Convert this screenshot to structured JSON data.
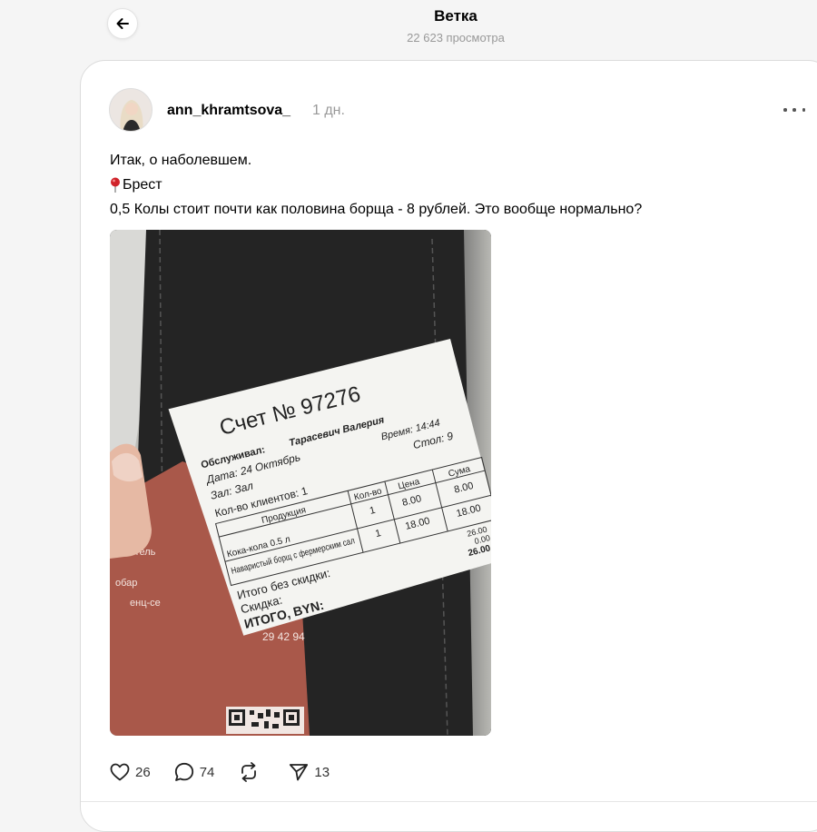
{
  "header": {
    "title": "Ветка",
    "views": "22 623 просмотра"
  },
  "post": {
    "username": "ann_khramtsova_",
    "time": "1 дн.",
    "lines": [
      "Итак, о наболевшем.",
      "Брест",
      "0,5 Колы стоит почти как половина борща - 8 рублей. Это вообще нормально?"
    ],
    "receipt": {
      "title": "Счет № 97276",
      "served_label": "Обслуживал:",
      "waiter": "Тарасевич Валерия",
      "date": "Дата: 24 Октябрь",
      "time": "Время: 14:44",
      "hall": "Зал: Зал",
      "table": "Стол: 9",
      "clients": "Кол-во клиентов: 1",
      "col_product": "Продукция",
      "col_qty": "Кол-во",
      "col_price": "Цена",
      "col_sum": "Сума",
      "items": [
        {
          "name": "Кока-кола 0.5 л",
          "qty": "1",
          "price": "8.00",
          "sum": "8.00"
        },
        {
          "name": "Наваристый борщ с фермерским сал",
          "qty": "1",
          "price": "18.00",
          "sum": "18.00"
        }
      ],
      "subtotal_label": "Итого без скидки:",
      "subtotal": "26.00",
      "discount_label": "Скидка:",
      "discount": "0.00",
      "total_label": "ИТОГО, BYN:",
      "total": "26.00",
      "menu_lines": [
        "тик-отель",
        "обар",
        "енц-се"
      ],
      "menu_phone": "29 42 94"
    },
    "likes": "26",
    "comments": "74",
    "reposts_icon": "repost-icon",
    "shares": "13"
  },
  "colors": {
    "background": "#f5f5f5",
    "card": "#ffffff",
    "muted": "#999999",
    "pin": "#d0232a",
    "menu_card": "#a9584a"
  }
}
